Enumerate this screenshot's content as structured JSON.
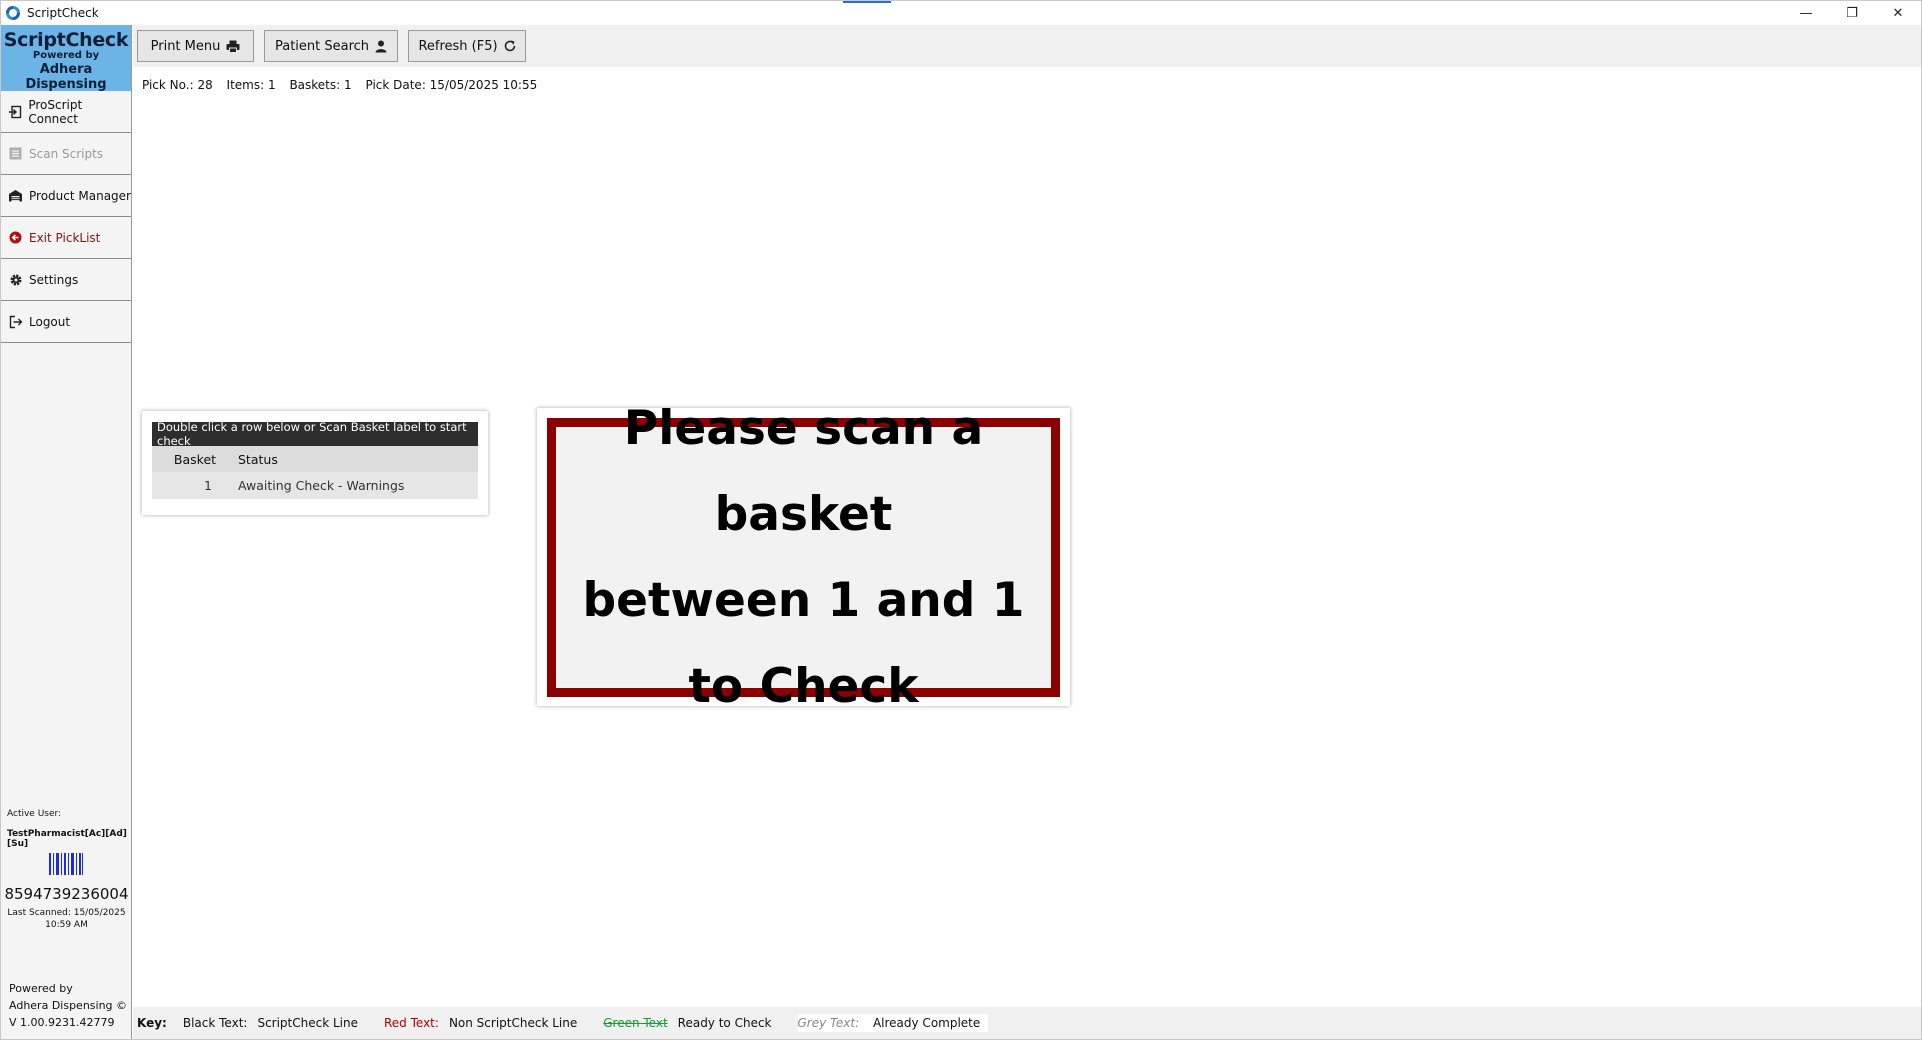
{
  "window": {
    "title": "ScriptCheck",
    "controls": {
      "minimize": "—",
      "restore": "❐",
      "close": "✕"
    }
  },
  "sidebar": {
    "brand": {
      "name": "ScriptCheck",
      "powered_by": "Powered by",
      "company": "Adhera Dispensing"
    },
    "items": [
      {
        "label": "ProScript Connect",
        "icon": "login-arrow-icon",
        "state": "normal"
      },
      {
        "label": "Scan Scripts",
        "icon": "list-icon",
        "state": "disabled"
      },
      {
        "label": "Product Manager",
        "icon": "warehouse-icon",
        "state": "normal"
      },
      {
        "label": "Exit PickList",
        "icon": "circle-arrow-left-icon",
        "state": "exit"
      },
      {
        "label": "Settings",
        "icon": "gear-icon",
        "state": "normal"
      },
      {
        "label": "Logout",
        "icon": "logout-icon",
        "state": "normal"
      }
    ],
    "active_user_label": "Active User:",
    "active_user_name": "TestPharmacist[Ac][Ad][Su]",
    "barcode_number": "8594739236004",
    "last_scanned_line1": "Last Scanned: 15/05/2025",
    "last_scanned_line2": "10:59 AM",
    "footer_line1": "Powered by",
    "footer_line2": "Adhera Dispensing ©",
    "footer_line3": "V 1.00.9231.42779"
  },
  "toolbar": {
    "print_menu": "Print Menu",
    "patient_search": "Patient Search",
    "refresh": "Refresh (F5)"
  },
  "pick_info": {
    "pick_no": "Pick No.: 28",
    "items": "Items: 1",
    "baskets": "Baskets: 1",
    "pick_date": "Pick Date: 15/05/2025 10:55"
  },
  "basket_table": {
    "header": "Double click a row below or Scan Basket label to start check",
    "columns": [
      "Basket",
      "Status"
    ],
    "rows": [
      {
        "basket": "1",
        "status": "Awaiting Check - Warnings"
      }
    ]
  },
  "message": {
    "line1": "Please scan a basket",
    "line2": "between 1 and 1",
    "line3": "to Check"
  },
  "key": {
    "label": "Key:",
    "black_label": "Black Text:",
    "black_desc": "ScriptCheck Line",
    "red_label": "Red Text:",
    "red_desc": "Non ScriptCheck Line",
    "green_label": "Green Text",
    "green_desc": "Ready to Check",
    "grey_label": "Grey Text:",
    "grey_desc": "Already Complete"
  },
  "colors": {
    "brand": "#6cb4e6",
    "message_border": "#8b0000",
    "exit_text": "#8b0d0d",
    "barcode": "#1b2fd6"
  }
}
